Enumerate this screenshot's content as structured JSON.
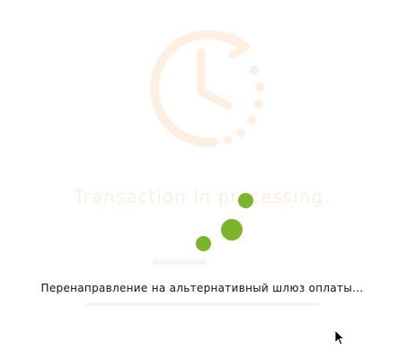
{
  "background": {
    "title": "Transaction in processing.",
    "accent_color": "#fbe9d8",
    "icon": "clock-history-icon"
  },
  "spinner": {
    "color": "#7cb52d",
    "icon": "loading-dots-icon"
  },
  "status": {
    "message": "Перенаправление на альтернативный шлюз оплаты..."
  },
  "cursor": {
    "icon": "mouse-pointer-icon"
  }
}
